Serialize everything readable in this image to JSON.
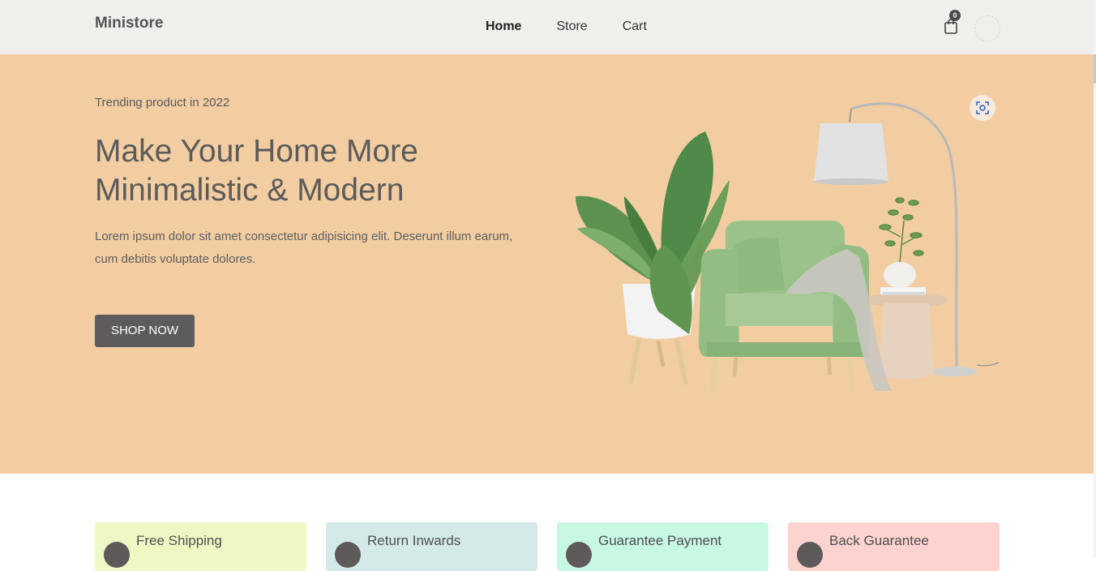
{
  "navbar": {
    "brand": "Ministore",
    "links": [
      {
        "label": "Home",
        "active": true
      },
      {
        "label": "Store",
        "active": false
      },
      {
        "label": "Cart",
        "active": false
      }
    ],
    "cart_count": "0",
    "cart_icon": "shopping-bag-icon",
    "user_icon": "user-avatar-icon"
  },
  "hero": {
    "eyebrow": "Trending product in 2022",
    "headline": "Make Your Home More Minimalistic & Modern",
    "lead": "Lorem ipsum dolor sit amet consectetur adipisicing elit. Deserunt illum earum, cum debitis voluptate dolores.",
    "cta": "SHOP NOW",
    "image_icon": "armchair-plant-lamp-illustration",
    "lens_icon": "visual-search-icon",
    "background": "#f2cda2"
  },
  "features": [
    {
      "title": "Free Shipping",
      "color": "#eef8c4",
      "icon": "truck-icon"
    },
    {
      "title": "Return Inwards",
      "color": "#d3eae8",
      "icon": "refresh-icon"
    },
    {
      "title": "Guarantee Payment",
      "color": "#c7f8e3",
      "icon": "secure-payment-icon"
    },
    {
      "title": "Back Guarantee",
      "color": "#fdd3d0",
      "icon": "back-arrow-icon"
    }
  ]
}
